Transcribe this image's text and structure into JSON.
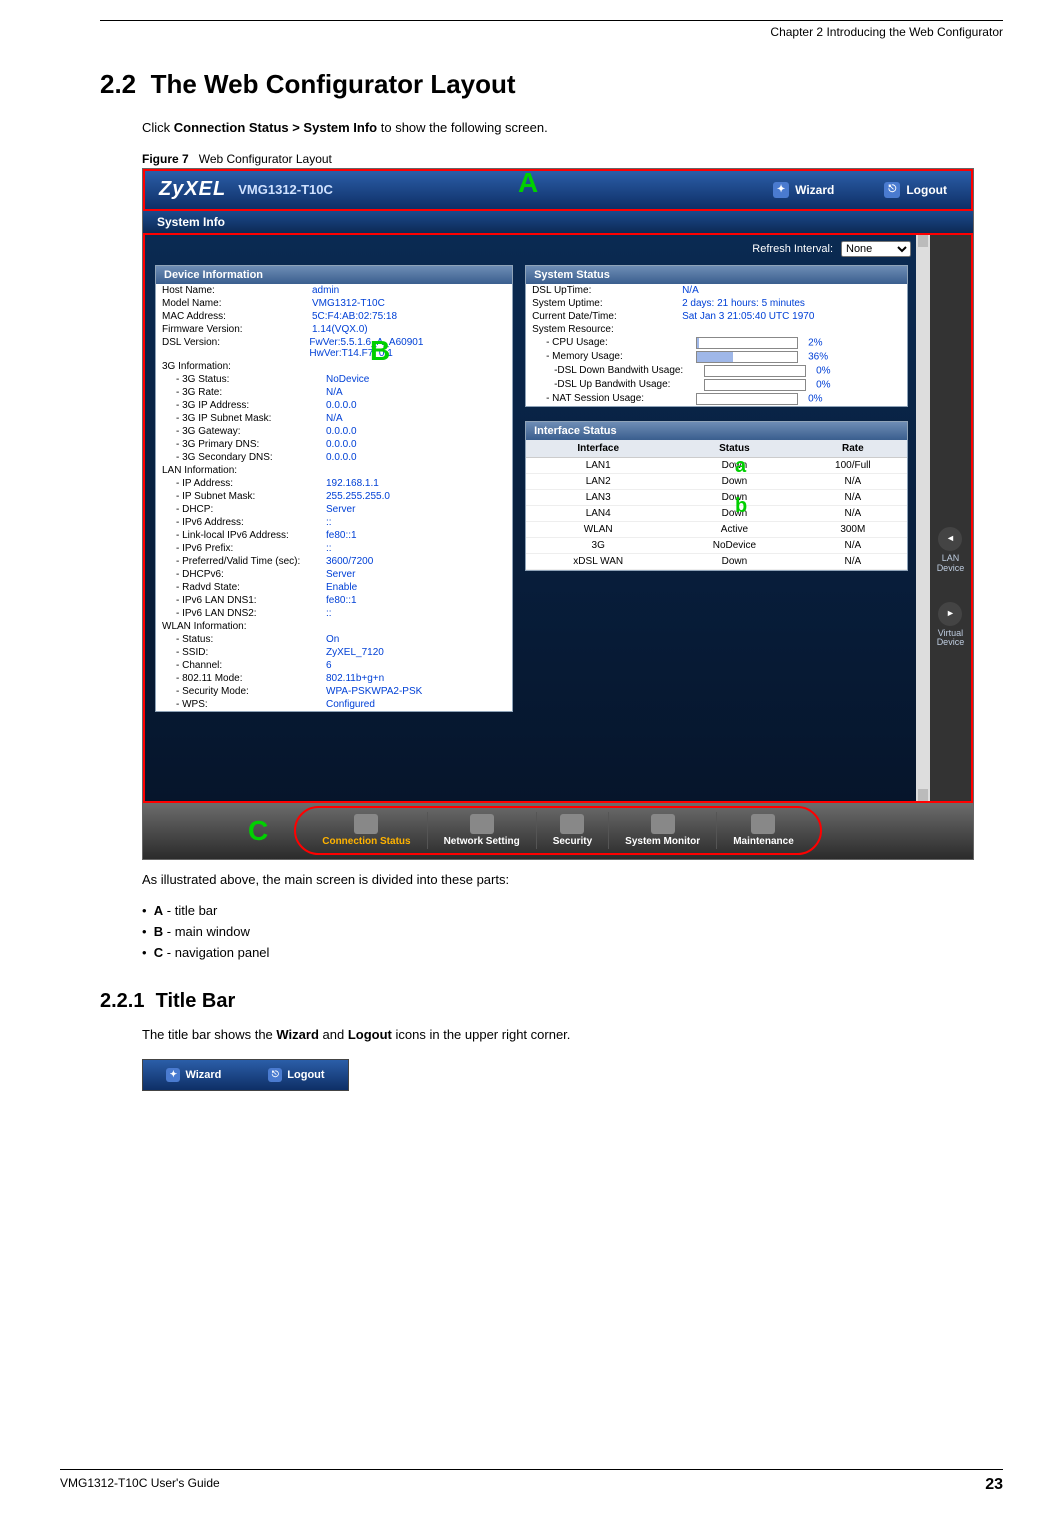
{
  "doc": {
    "chapter_head": "Chapter 2 Introducing the Web Configurator",
    "section_num": "2.2",
    "section_title": "The Web Configurator Layout",
    "intro_prefix": "Click ",
    "intro_bold": "Connection Status > System Info",
    "intro_suffix": " to show the following screen.",
    "figure_label": "Figure 7",
    "figure_title": "Web Configurator Layout",
    "para2": "As illustrated above, the main screen is divided into these parts:",
    "parts": [
      {
        "letter": "A",
        "desc": "title bar"
      },
      {
        "letter": "B",
        "desc": "main window"
      },
      {
        "letter": "C",
        "desc": "navigation panel"
      }
    ],
    "sub_num": "2.2.1",
    "sub_title": "Title Bar",
    "sub_para_a": "The title bar shows the ",
    "sub_para_b": "Wizard",
    "sub_para_c": " and ",
    "sub_para_d": "Logout",
    "sub_para_e": " icons in the upper right corner.",
    "footer_left": "VMG1312-T10C User's Guide",
    "footer_right": "23"
  },
  "screenshot": {
    "logo": "ZyXEL",
    "model": "VMG1312-T10C",
    "wizard": "Wizard",
    "logout": "Logout",
    "sysinfo_tab": "System Info",
    "refresh_label": "Refresh Interval:",
    "refresh_value": "None",
    "labels": {
      "A": "A",
      "B": "B",
      "C": "C",
      "a": "a",
      "b": "b"
    },
    "side": {
      "lan": "LAN Device",
      "virtual": "Virtual Device"
    },
    "panel_device": "Device Information",
    "panel_status": "System Status",
    "panel_iface": "Interface Status",
    "device_info": [
      {
        "k": "Host Name:",
        "v": "admin"
      },
      {
        "k": "Model Name:",
        "v": "VMG1312-T10C"
      },
      {
        "k": "MAC Address:",
        "v": "5C:F4:AB:02:75:18"
      },
      {
        "k": "Firmware Version:",
        "v": "1.14(VQX.0)"
      },
      {
        "k": "DSL Version:",
        "v": "FwVer:5.5.1.6_A_A60901 HwVer:T14.F7_0.1"
      },
      {
        "k": "3G Information:",
        "v": ""
      },
      {
        "k": "- 3G Status:",
        "v": "NoDevice",
        "sub": true
      },
      {
        "k": "- 3G Rate:",
        "v": "N/A",
        "sub": true
      },
      {
        "k": "- 3G IP Address:",
        "v": "0.0.0.0",
        "sub": true
      },
      {
        "k": "- 3G IP Subnet Mask:",
        "v": "N/A",
        "sub": true
      },
      {
        "k": "- 3G Gateway:",
        "v": "0.0.0.0",
        "sub": true
      },
      {
        "k": "- 3G Primary DNS:",
        "v": "0.0.0.0",
        "sub": true
      },
      {
        "k": "- 3G Secondary DNS:",
        "v": "0.0.0.0",
        "sub": true
      },
      {
        "k": "LAN Information:",
        "v": ""
      },
      {
        "k": "- IP Address:",
        "v": "192.168.1.1",
        "sub": true
      },
      {
        "k": "- IP Subnet Mask:",
        "v": "255.255.255.0",
        "sub": true
      },
      {
        "k": "- DHCP:",
        "v": "Server",
        "sub": true
      },
      {
        "k": "- IPv6 Address:",
        "v": "::",
        "sub": true
      },
      {
        "k": "- Link-local IPv6 Address:",
        "v": "fe80::1",
        "sub": true
      },
      {
        "k": "- IPv6 Prefix:",
        "v": "::",
        "sub": true
      },
      {
        "k": "- Preferred/Valid Time (sec):",
        "v": "3600/7200",
        "sub": true
      },
      {
        "k": "- DHCPv6:",
        "v": "Server",
        "sub": true
      },
      {
        "k": "- Radvd State:",
        "v": "Enable",
        "sub": true
      },
      {
        "k": "- IPv6 LAN DNS1:",
        "v": "fe80::1",
        "sub": true
      },
      {
        "k": "- IPv6 LAN DNS2:",
        "v": "::",
        "sub": true
      },
      {
        "k": "WLAN Information:",
        "v": ""
      },
      {
        "k": "- Status:",
        "v": "On",
        "sub": true
      },
      {
        "k": "- SSID:",
        "v": "ZyXEL_7120",
        "sub": true
      },
      {
        "k": "- Channel:",
        "v": "6",
        "sub": true
      },
      {
        "k": "- 802.11 Mode:",
        "v": "802.11b+g+n",
        "sub": true
      },
      {
        "k": "- Security Mode:",
        "v": "WPA-PSKWPA2-PSK",
        "sub": true
      },
      {
        "k": "- WPS:",
        "v": "Configured",
        "sub": true
      }
    ],
    "system_status": [
      {
        "k": "DSL UpTime:",
        "v": "N/A"
      },
      {
        "k": "System Uptime:",
        "v": "2 days: 21 hours: 5 minutes"
      },
      {
        "k": "Current Date/Time:",
        "v": "Sat Jan 3 21:05:40 UTC 1970"
      },
      {
        "k": "System Resource:",
        "v": ""
      },
      {
        "k": "- CPU Usage:",
        "bar": 2,
        "v": "2%",
        "sub": true
      },
      {
        "k": "- Memory Usage:",
        "bar": 36,
        "v": "36%",
        "sub": true
      },
      {
        "k": "-DSL Down Bandwith Usage:",
        "bar": 0,
        "v": "0%",
        "sub2": true
      },
      {
        "k": "-DSL Up Bandwith Usage:",
        "bar": 0,
        "v": "0%",
        "sub2": true
      },
      {
        "k": "- NAT Session Usage:",
        "bar": 0,
        "v": "0%",
        "sub": true
      }
    ],
    "iface_headers": {
      "h1": "Interface",
      "h2": "Status",
      "h3": "Rate"
    },
    "interfaces": [
      {
        "name": "LAN1",
        "status": "Down",
        "rate": "100/Full"
      },
      {
        "name": "LAN2",
        "status": "Down",
        "rate": "N/A"
      },
      {
        "name": "LAN3",
        "status": "Down",
        "rate": "N/A"
      },
      {
        "name": "LAN4",
        "status": "Down",
        "rate": "N/A"
      },
      {
        "name": "WLAN",
        "status": "Active",
        "rate": "300M"
      },
      {
        "name": "3G",
        "status": "NoDevice",
        "rate": "N/A"
      },
      {
        "name": "xDSL WAN",
        "status": "Down",
        "rate": "N/A"
      }
    ],
    "nav": [
      {
        "label": "Connection Status",
        "active": true
      },
      {
        "label": "Network Setting"
      },
      {
        "label": "Security"
      },
      {
        "label": "System Monitor"
      },
      {
        "label": "Maintenance"
      }
    ]
  }
}
